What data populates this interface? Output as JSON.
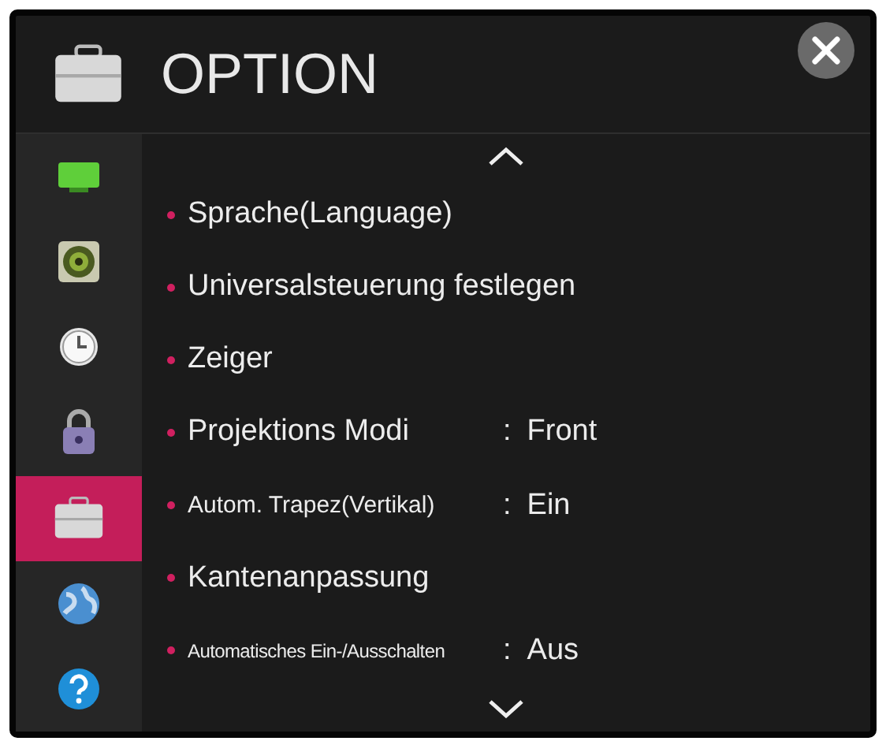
{
  "window": {
    "title": "OPTION"
  },
  "sidebar": {
    "items": [
      {
        "kind": "picture",
        "selected": false
      },
      {
        "kind": "audio",
        "selected": false
      },
      {
        "kind": "time",
        "selected": false
      },
      {
        "kind": "lock",
        "selected": false
      },
      {
        "kind": "option",
        "selected": true
      },
      {
        "kind": "network",
        "selected": false
      },
      {
        "kind": "support",
        "selected": false
      }
    ]
  },
  "menu": {
    "items": [
      {
        "kind": "normal",
        "label": "Sprache(Language)"
      },
      {
        "kind": "normal",
        "label": "Universalsteuerung festlegen"
      },
      {
        "kind": "normal",
        "label": "Zeiger"
      },
      {
        "kind": "normal",
        "label": "Projektions Modi",
        "separator": ":",
        "value": "Front"
      },
      {
        "kind": "small",
        "label": "Autom. Trapez(Vertikal)",
        "separator": ":",
        "value": "Ein"
      },
      {
        "kind": "normal",
        "label": "Kantenanpassung"
      },
      {
        "kind": "tiny",
        "label": "Automatisches Ein-/Ausschalten",
        "separator": ":",
        "value": "Aus"
      }
    ]
  }
}
